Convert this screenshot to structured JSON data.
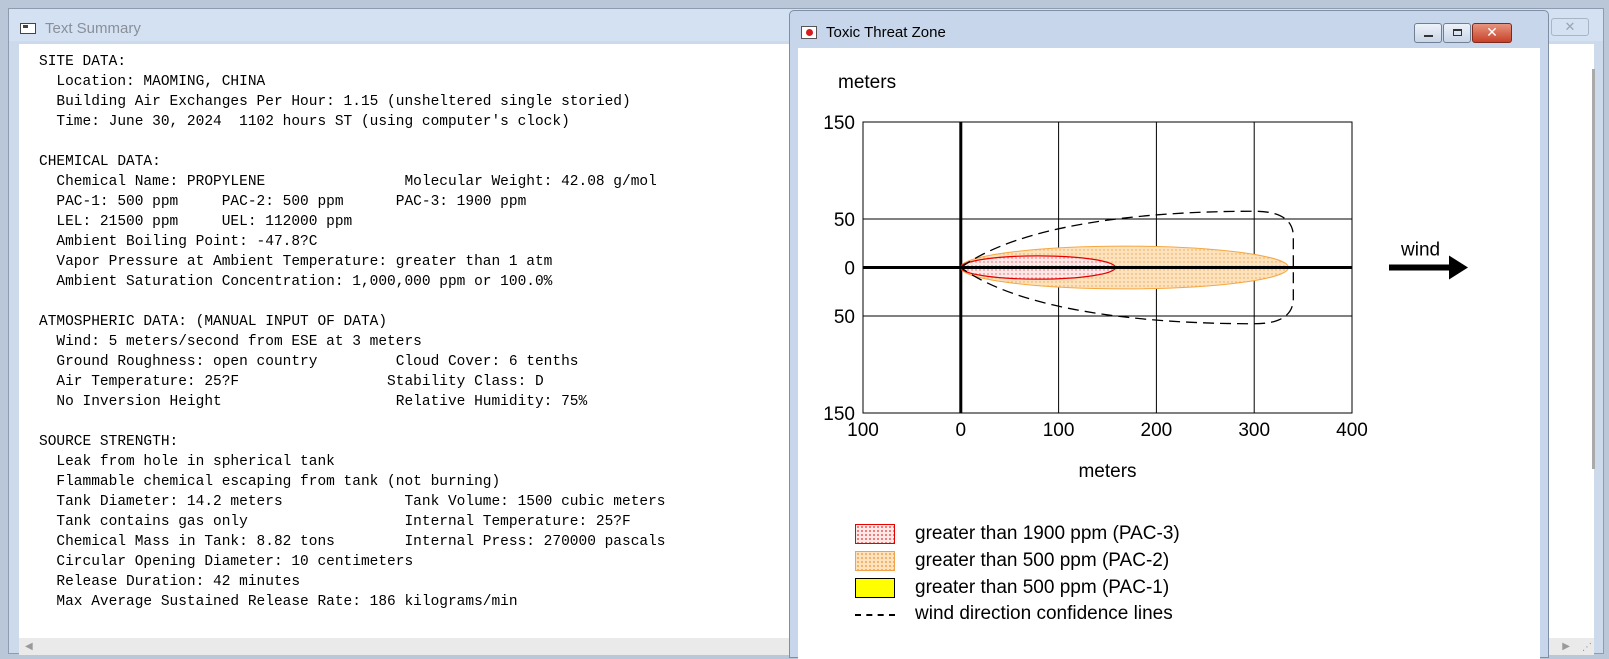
{
  "summary_window": {
    "title": "Text Summary",
    "lines": [
      "SITE DATA:",
      "  Location: MAOMING, CHINA",
      "  Building Air Exchanges Per Hour: 1.15 (unsheltered single storied)",
      "  Time: June 30, 2024  1102 hours ST (using computer's clock)",
      "",
      "CHEMICAL DATA:",
      "  Chemical Name: PROPYLENE                Molecular Weight: 42.08 g/mol",
      "  PAC-1: 500 ppm     PAC-2: 500 ppm      PAC-3: 1900 ppm",
      "  LEL: 21500 ppm     UEL: 112000 ppm",
      "  Ambient Boiling Point: -47.8?C",
      "  Vapor Pressure at Ambient Temperature: greater than 1 atm",
      "  Ambient Saturation Concentration: 1,000,000 ppm or 100.0%",
      "",
      "ATMOSPHERIC DATA: (MANUAL INPUT OF DATA)",
      "  Wind: 5 meters/second from ESE at 3 meters",
      "  Ground Roughness: open country         Cloud Cover: 6 tenths",
      "  Air Temperature: 25?F                 Stability Class: D",
      "  No Inversion Height                    Relative Humidity: 75%",
      "",
      "SOURCE STRENGTH:",
      "  Leak from hole in spherical tank",
      "  Flammable chemical escaping from tank (not burning)",
      "  Tank Diameter: 14.2 meters              Tank Volume: 1500 cubic meters",
      "  Tank contains gas only                  Internal Temperature: 25?F",
      "  Chemical Mass in Tank: 8.82 tons        Internal Press: 270000 pascals",
      "  Circular Opening Diameter: 10 centimeters",
      "  Release Duration: 42 minutes",
      "  Max Average Sustained Release Rate: 186 kilograms/min"
    ]
  },
  "threat_window": {
    "title": "Toxic Threat Zone",
    "close_glyph": "✕",
    "wind_label": "wind",
    "legend": [
      {
        "label": "greater than 1900 ppm (PAC-3)"
      },
      {
        "label": "greater than 500 ppm (PAC-2)"
      },
      {
        "label": "greater than 500 ppm (PAC-1)"
      },
      {
        "label": "wind direction confidence lines"
      }
    ]
  },
  "chart_data": {
    "type": "area",
    "y_axis_title": "meters",
    "x_axis_title": "meters",
    "x_ticks": [
      -100,
      0,
      100,
      200,
      300,
      400
    ],
    "x_tick_labels": [
      "100",
      "0",
      "100",
      "200",
      "300",
      "400"
    ],
    "y_ticks": [
      150,
      50,
      0,
      -50,
      -150
    ],
    "y_tick_labels": [
      "150",
      "50",
      "0",
      "50",
      "150"
    ],
    "xlim": [
      -100,
      400
    ],
    "ylim": [
      -150,
      150
    ],
    "grid": true,
    "colors": {
      "pac3": "#e60000",
      "pac2": "#f5a742",
      "pac1": "#ffff00",
      "confidence": "#000000"
    },
    "series": [
      {
        "name": "greater than 1900 ppm (PAC-3)",
        "shape": "ellipse",
        "x_start": 0,
        "x_end": 158,
        "half_width": 12
      },
      {
        "name": "greater than 500 ppm (PAC-2)",
        "shape": "ellipse",
        "x_start": 0,
        "x_end": 335,
        "half_width": 22
      },
      {
        "name": "wind direction confidence lines",
        "shape": "dashed-boundary",
        "x_start": 0,
        "x_end": 340,
        "half_width": 58
      }
    ]
  }
}
